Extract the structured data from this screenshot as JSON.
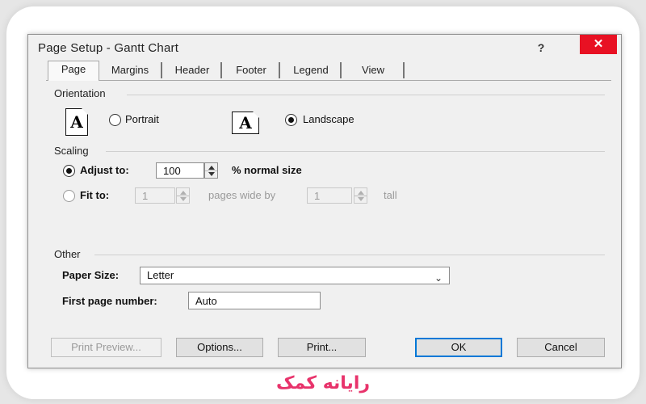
{
  "dialog": {
    "title": "Page Setup - Gantt Chart",
    "help_glyph": "?",
    "close_glyph": "✕"
  },
  "tabs": [
    {
      "label": "Page",
      "active": true
    },
    {
      "label": "Margins",
      "active": false
    },
    {
      "label": "Header",
      "active": false
    },
    {
      "label": "Footer",
      "active": false
    },
    {
      "label": "Legend",
      "active": false
    },
    {
      "label": "View",
      "active": false
    }
  ],
  "orientation": {
    "section_label": "Orientation",
    "icon_letter": "A",
    "portrait_label": "Portrait",
    "landscape_label": "Landscape",
    "selected": "landscape"
  },
  "scaling": {
    "section_label": "Scaling",
    "adjust_label": "Adjust to:",
    "adjust_value": "100",
    "adjust_suffix": "% normal size",
    "fit_label": "Fit to:",
    "fit_wide_value": "1",
    "fit_wide_suffix": "pages wide by",
    "fit_tall_value": "1",
    "fit_tall_suffix": "tall",
    "selected": "adjust"
  },
  "other": {
    "section_label": "Other",
    "paper_size_label": "Paper Size:",
    "paper_size_value": "Letter",
    "first_page_label": "First page number:",
    "first_page_value": "Auto"
  },
  "buttons": {
    "print_preview": "Print Preview...",
    "options": "Options...",
    "print": "Print...",
    "ok": "OK",
    "cancel": "Cancel"
  },
  "colors": {
    "close_red": "#e81123",
    "default_button_border": "#0078d7",
    "watermark_pink": "#e8336b"
  },
  "watermark": "رایانه کمک"
}
